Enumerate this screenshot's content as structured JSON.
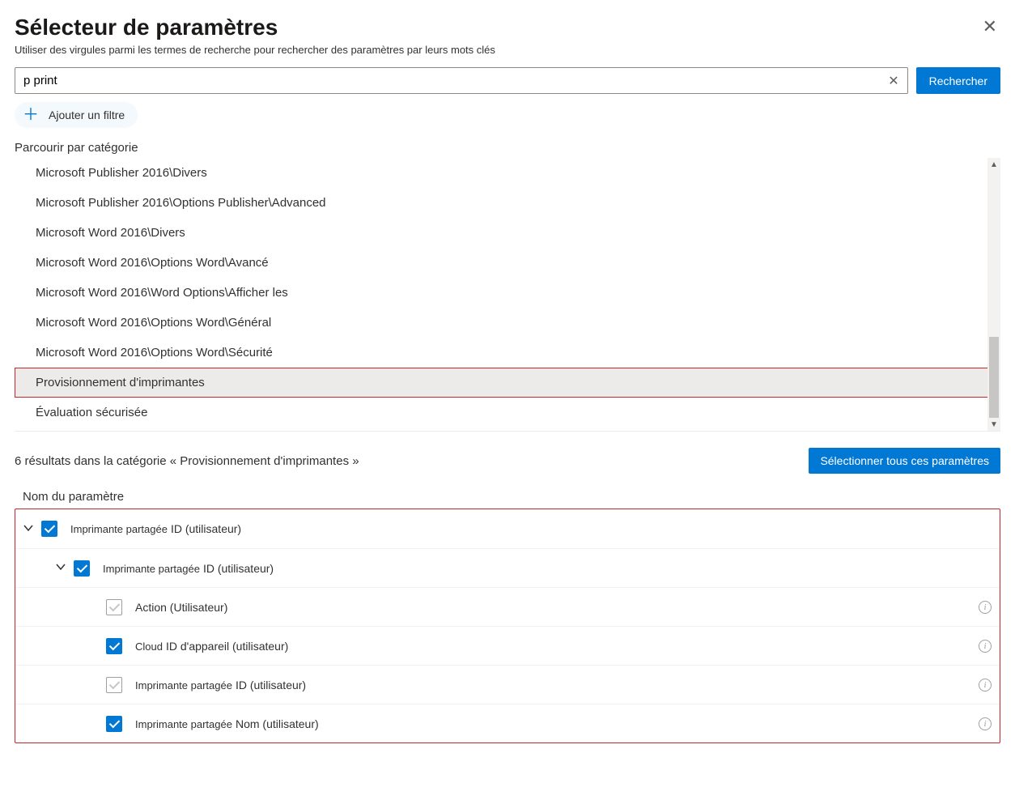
{
  "header": {
    "title": "Sélecteur de paramètres",
    "subtitle": "Utiliser des virgules parmi les termes de recherche pour rechercher des paramètres par leurs mots clés"
  },
  "search": {
    "value": "p print",
    "button": "Rechercher"
  },
  "addFilter": "Ajouter un filtre",
  "browseLabel": "Parcourir par catégorie",
  "categories": [
    {
      "label": "Microsoft Publisher 2016\\Divers",
      "selected": false
    },
    {
      "label": "Microsoft Publisher 2016\\Options Publisher\\Advanced",
      "selected": false
    },
    {
      "label": "Microsoft Word 2016\\Divers",
      "selected": false
    },
    {
      "label": "Microsoft Word 2016\\Options Word\\Avancé",
      "selected": false
    },
    {
      "label": "Microsoft Word 2016\\Word Options\\Afficher les",
      "selected": false
    },
    {
      "label": "Microsoft Word 2016\\Options Word\\Général",
      "selected": false
    },
    {
      "label": "Microsoft Word 2016\\Options Word\\Sécurité",
      "selected": false
    },
    {
      "label": "Provisionnement d'imprimantes",
      "selected": true
    },
    {
      "label": "Évaluation sécurisée",
      "selected": false
    }
  ],
  "results": {
    "countText": "6 résultats dans la catégorie « Provisionnement d'imprimantes »",
    "selectAll": "Sélectionner tous ces paramètres",
    "columnHeader": "Nom du paramètre"
  },
  "tree": [
    {
      "level": 0,
      "chevron": true,
      "checked": true,
      "pre": "Imprimante partagée",
      "main": "ID (utilisateur)",
      "info": false
    },
    {
      "level": 1,
      "chevron": true,
      "checked": true,
      "pre": "Imprimante partagée",
      "main": "ID (utilisateur)",
      "info": false
    },
    {
      "level": 2,
      "chevron": false,
      "checked": "grey",
      "pre": "",
      "main": "Action (Utilisateur)",
      "info": true
    },
    {
      "level": 2,
      "chevron": false,
      "checked": true,
      "pre": "Cloud",
      "main": "ID d'appareil (utilisateur)",
      "info": true
    },
    {
      "level": 2,
      "chevron": false,
      "checked": "grey",
      "pre": "Imprimante partagée",
      "main": "ID (utilisateur)",
      "info": true
    },
    {
      "level": 2,
      "chevron": false,
      "checked": true,
      "pre": "Imprimante partagée",
      "main": "Nom (utilisateur)",
      "info": true
    }
  ]
}
